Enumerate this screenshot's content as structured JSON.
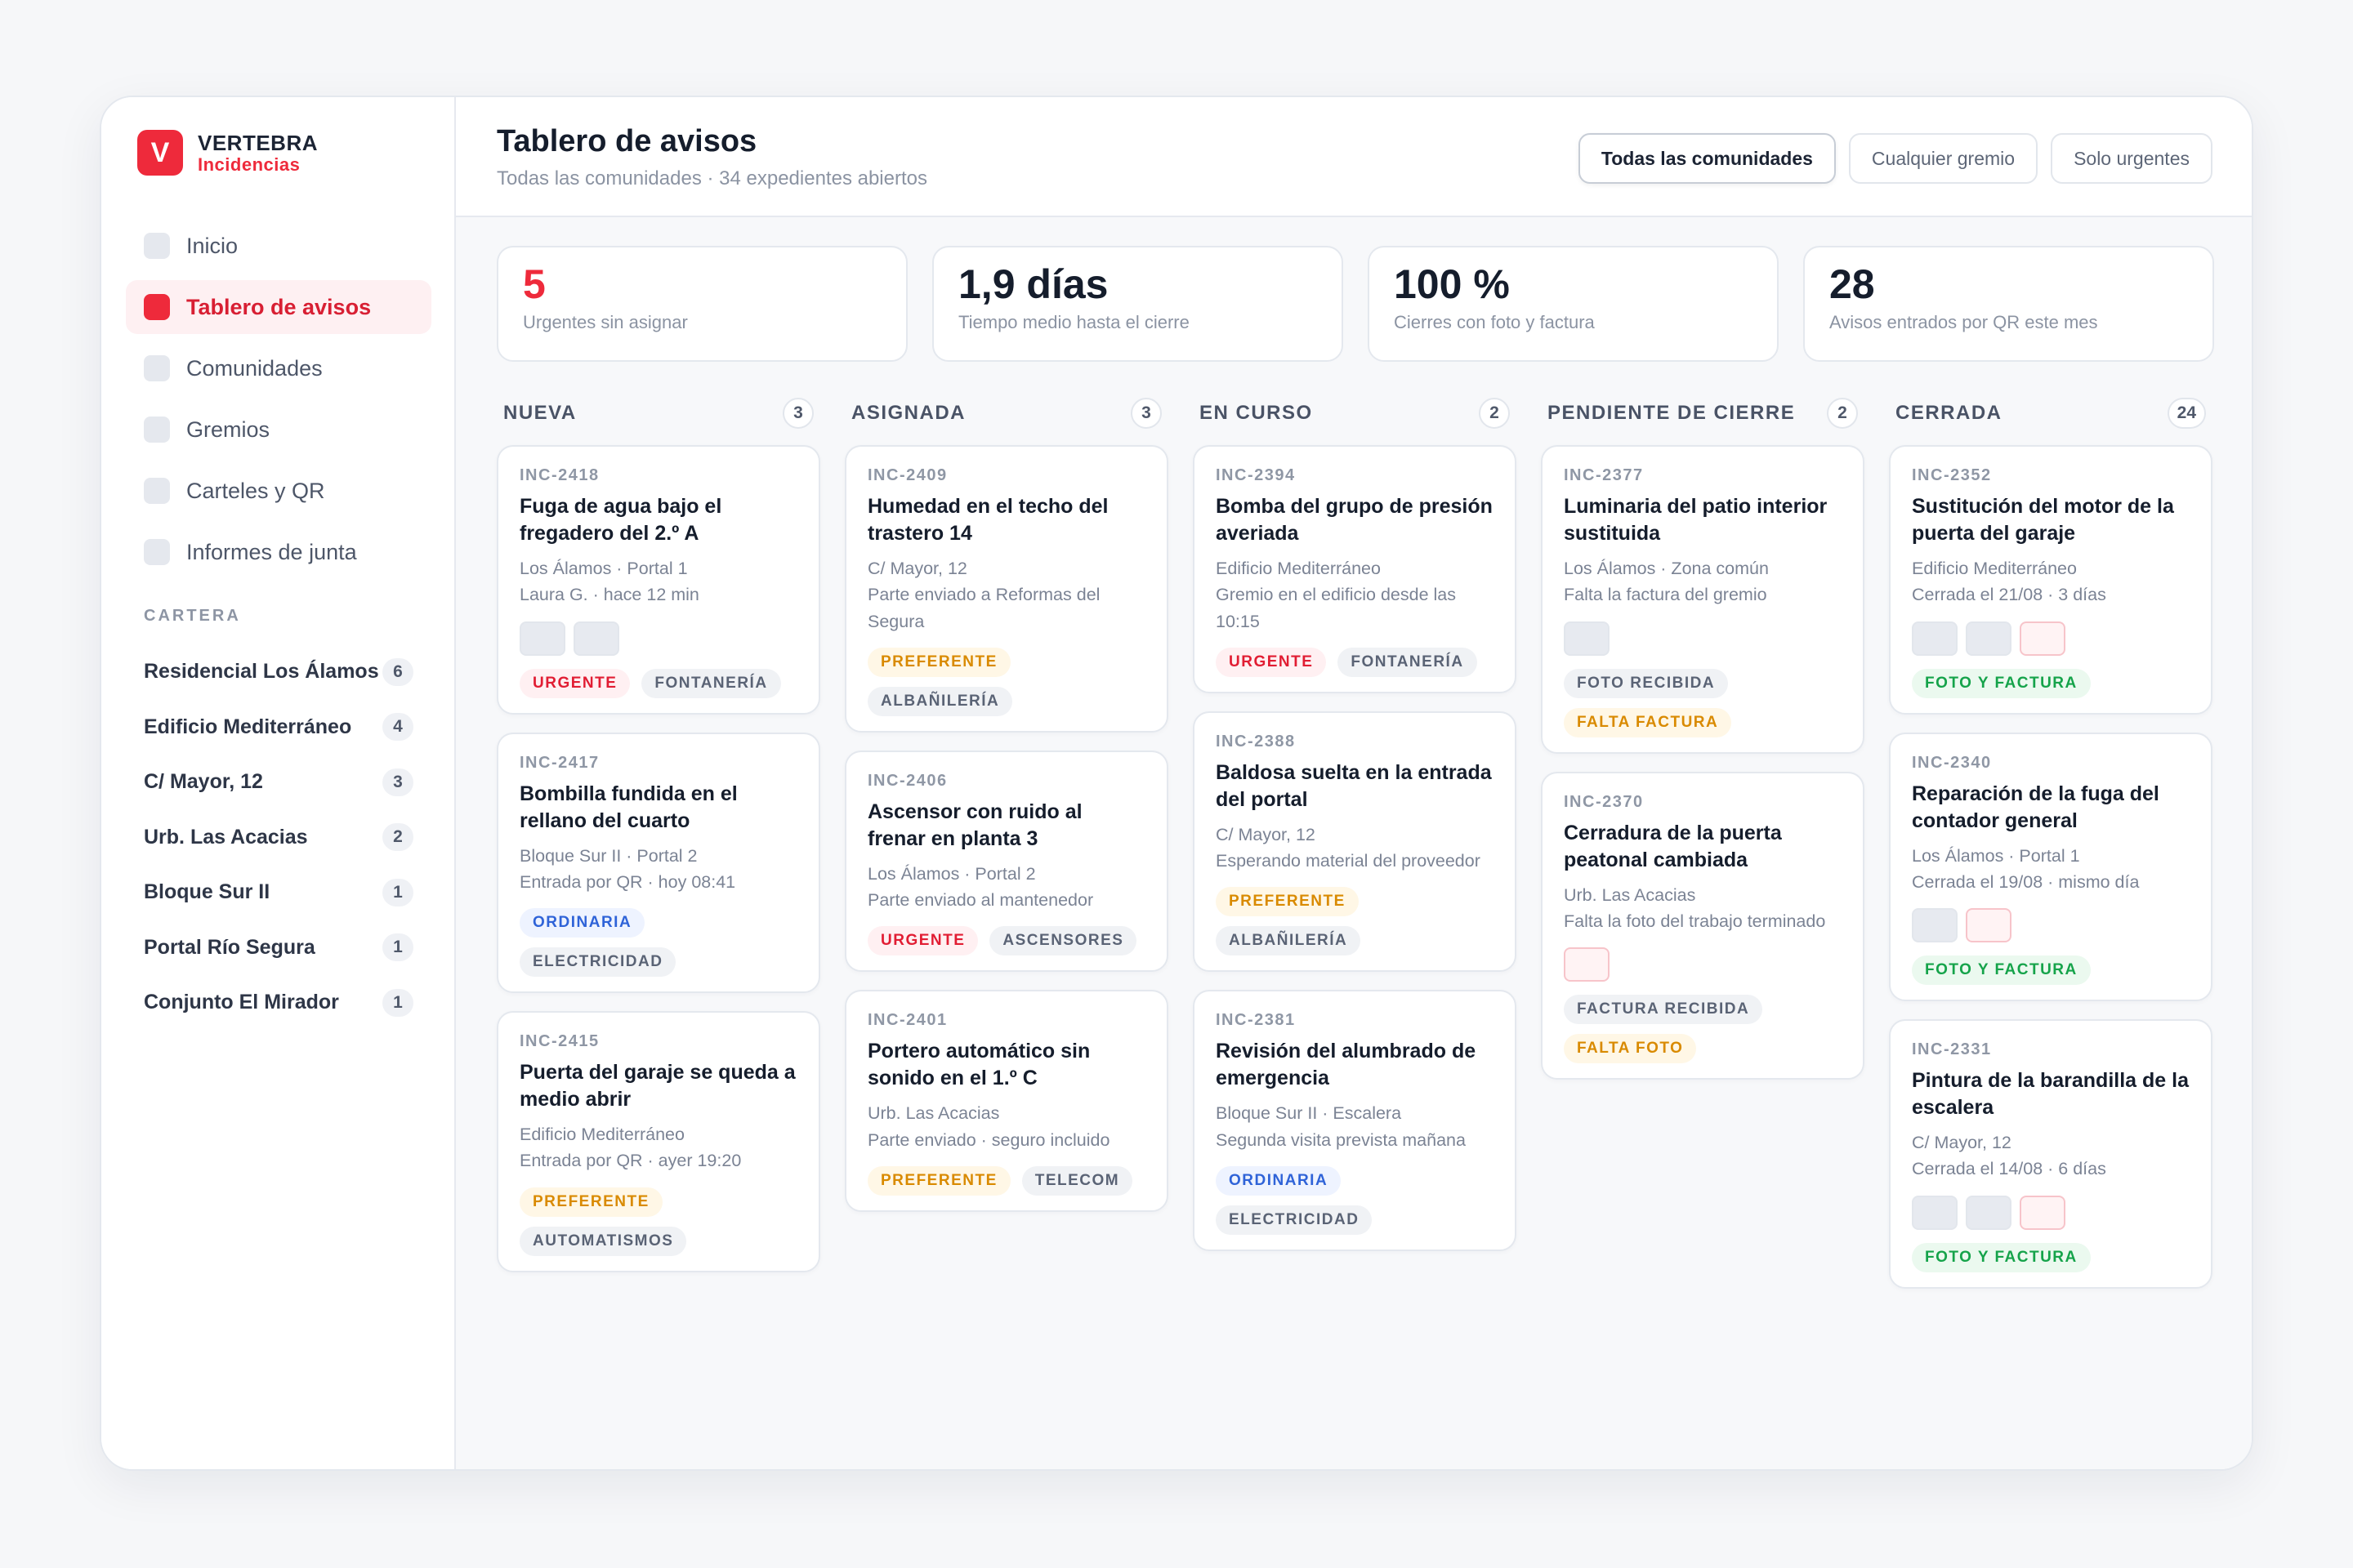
{
  "brand": {
    "logo_letter": "V",
    "name": "VERTEBRA",
    "sub": "Incidencias"
  },
  "colors": {
    "accent": "#ee2a3b",
    "urgent": "#e11d33",
    "preferente": "#d98a00",
    "ordinaria": "#2f63d8",
    "ok": "#15a34a"
  },
  "nav": [
    {
      "label": "Inicio",
      "active": false
    },
    {
      "label": "Tablero de avisos",
      "active": true
    },
    {
      "label": "Comunidades",
      "active": false
    },
    {
      "label": "Gremios",
      "active": false
    },
    {
      "label": "Carteles y QR",
      "active": false
    },
    {
      "label": "Informes de junta",
      "active": false
    }
  ],
  "portfolio": {
    "label": "CARTERA",
    "items": [
      {
        "name": "Residencial Los Álamos",
        "count": "6"
      },
      {
        "name": "Edificio Mediterráneo",
        "count": "4"
      },
      {
        "name": "C/ Mayor, 12",
        "count": "3"
      },
      {
        "name": "Urb. Las Acacias",
        "count": "2"
      },
      {
        "name": "Bloque Sur II",
        "count": "1"
      },
      {
        "name": "Portal Río Segura",
        "count": "1"
      },
      {
        "name": "Conjunto El Mirador",
        "count": "1"
      }
    ]
  },
  "header": {
    "title": "Tablero de avisos",
    "subtitle": "Todas las comunidades · 34 expedientes abiertos",
    "filters": [
      {
        "label": "Todas las comunidades",
        "active": true
      },
      {
        "label": "Cualquier gremio",
        "active": false
      },
      {
        "label": "Solo urgentes",
        "active": false
      }
    ]
  },
  "stats": [
    {
      "value": "5",
      "label": "Urgentes sin asignar",
      "highlight": true
    },
    {
      "value": "1,9 días",
      "label": "Tiempo medio hasta el cierre",
      "highlight": false
    },
    {
      "value": "100 %",
      "label": "Cierres con foto y factura",
      "highlight": false
    },
    {
      "value": "28",
      "label": "Avisos entrados por QR este mes",
      "highlight": false
    }
  ],
  "columns": [
    {
      "title": "NUEVA",
      "count": "3",
      "cards": [
        {
          "id": "INC-2418",
          "title": "Fuga de agua bajo el fregadero del 2.º A",
          "meta": [
            "Los Álamos · Portal 1",
            "Laura G. · hace 12 min"
          ],
          "thumbs": [
            "img",
            "img"
          ],
          "tags": [
            {
              "label": "URGENTE",
              "kind": "urgent"
            },
            {
              "label": "FONTANERÍA",
              "kind": "neutral"
            }
          ]
        },
        {
          "id": "INC-2417",
          "title": "Bombilla fundida en el rellano del cuarto",
          "meta": [
            "Bloque Sur II · Portal 2",
            "Entrada por QR · hoy 08:41"
          ],
          "thumbs": [],
          "tags": [
            {
              "label": "ORDINARIA",
              "kind": "ord"
            },
            {
              "label": "ELECTRICIDAD",
              "kind": "neutral"
            }
          ]
        },
        {
          "id": "INC-2415",
          "title": "Puerta del garaje se queda a medio abrir",
          "meta": [
            "Edificio Mediterráneo",
            "Entrada por QR · ayer 19:20"
          ],
          "thumbs": [],
          "tags": [
            {
              "label": "PREFERENTE",
              "kind": "pref"
            },
            {
              "label": "AUTOMATISMOS",
              "kind": "neutral"
            }
          ]
        }
      ]
    },
    {
      "title": "ASIGNADA",
      "count": "3",
      "cards": [
        {
          "id": "INC-2409",
          "title": "Humedad en el techo del trastero 14",
          "meta": [
            "C/ Mayor, 12",
            "Parte enviado a Reformas del Segura"
          ],
          "thumbs": [],
          "tags": [
            {
              "label": "PREFERENTE",
              "kind": "pref"
            },
            {
              "label": "ALBAÑILERÍA",
              "kind": "neutral"
            }
          ]
        },
        {
          "id": "INC-2406",
          "title": "Ascensor con ruido al frenar en planta 3",
          "meta": [
            "Los Álamos · Portal 2",
            "Parte enviado al mantenedor"
          ],
          "thumbs": [],
          "tags": [
            {
              "label": "URGENTE",
              "kind": "urgent"
            },
            {
              "label": "ASCENSORES",
              "kind": "neutral"
            }
          ]
        },
        {
          "id": "INC-2401",
          "title": "Portero automático sin sonido en el 1.º C",
          "meta": [
            "Urb. Las Acacias",
            "Parte enviado · seguro incluido"
          ],
          "thumbs": [],
          "tags": [
            {
              "label": "PREFERENTE",
              "kind": "pref"
            },
            {
              "label": "TELECOM",
              "kind": "neutral"
            }
          ]
        }
      ]
    },
    {
      "title": "EN CURSO",
      "count": "2",
      "cards": [
        {
          "id": "INC-2394",
          "title": "Bomba del grupo de presión averiada",
          "meta": [
            "Edificio Mediterráneo",
            "Gremio en el edificio desde las 10:15"
          ],
          "thumbs": [],
          "tags": [
            {
              "label": "URGENTE",
              "kind": "urgent"
            },
            {
              "label": "FONTANERÍA",
              "kind": "neutral"
            }
          ]
        },
        {
          "id": "INC-2388",
          "title": "Baldosa suelta en la entrada del portal",
          "meta": [
            "C/ Mayor, 12",
            "Esperando material del proveedor"
          ],
          "thumbs": [],
          "tags": [
            {
              "label": "PREFERENTE",
              "kind": "pref"
            },
            {
              "label": "ALBAÑILERÍA",
              "kind": "neutral"
            }
          ]
        },
        {
          "id": "INC-2381",
          "title": "Revisión del alumbrado de emergencia",
          "meta": [
            "Bloque Sur II · Escalera",
            "Segunda visita prevista mañana"
          ],
          "thumbs": [],
          "tags": [
            {
              "label": "ORDINARIA",
              "kind": "ord"
            },
            {
              "label": "ELECTRICIDAD",
              "kind": "neutral"
            }
          ]
        }
      ]
    },
    {
      "title": "PENDIENTE DE CIERRE",
      "count": "2",
      "cards": [
        {
          "id": "INC-2377",
          "title": "Luminaria del patio interior sustituida",
          "meta": [
            "Los Álamos · Zona común",
            "Falta la factura del gremio"
          ],
          "thumbs": [
            "img"
          ],
          "tags": [
            {
              "label": "FOTO RECIBIDA",
              "kind": "neutral"
            },
            {
              "label": "FALTA FACTURA",
              "kind": "pref"
            }
          ]
        },
        {
          "id": "INC-2370",
          "title": "Cerradura de la puerta peatonal cambiada",
          "meta": [
            "Urb. Las Acacias",
            "Falta la foto del trabajo terminado"
          ],
          "thumbs": [
            "pdf"
          ],
          "tags": [
            {
              "label": "FACTURA RECIBIDA",
              "kind": "neutral"
            },
            {
              "label": "FALTA FOTO",
              "kind": "pref"
            }
          ]
        }
      ]
    },
    {
      "title": "CERRADA",
      "count": "24",
      "cards": [
        {
          "id": "INC-2352",
          "title": "Sustitución del motor de la puerta del garaje",
          "meta": [
            "Edificio Mediterráneo",
            "Cerrada el 21/08 · 3 días"
          ],
          "thumbs": [
            "img",
            "img",
            "pdf"
          ],
          "tags": [
            {
              "label": "FOTO Y FACTURA",
              "kind": "ok"
            }
          ]
        },
        {
          "id": "INC-2340",
          "title": "Reparación de la fuga del contador general",
          "meta": [
            "Los Álamos · Portal 1",
            "Cerrada el 19/08 · mismo día"
          ],
          "thumbs": [
            "img",
            "pdf"
          ],
          "tags": [
            {
              "label": "FOTO Y FACTURA",
              "kind": "ok"
            }
          ]
        },
        {
          "id": "INC-2331",
          "title": "Pintura de la barandilla de la escalera",
          "meta": [
            "C/ Mayor, 12",
            "Cerrada el 14/08 · 6 días"
          ],
          "thumbs": [
            "img",
            "img",
            "pdf"
          ],
          "tags": [
            {
              "label": "FOTO Y FACTURA",
              "kind": "ok"
            }
          ]
        }
      ]
    }
  ]
}
